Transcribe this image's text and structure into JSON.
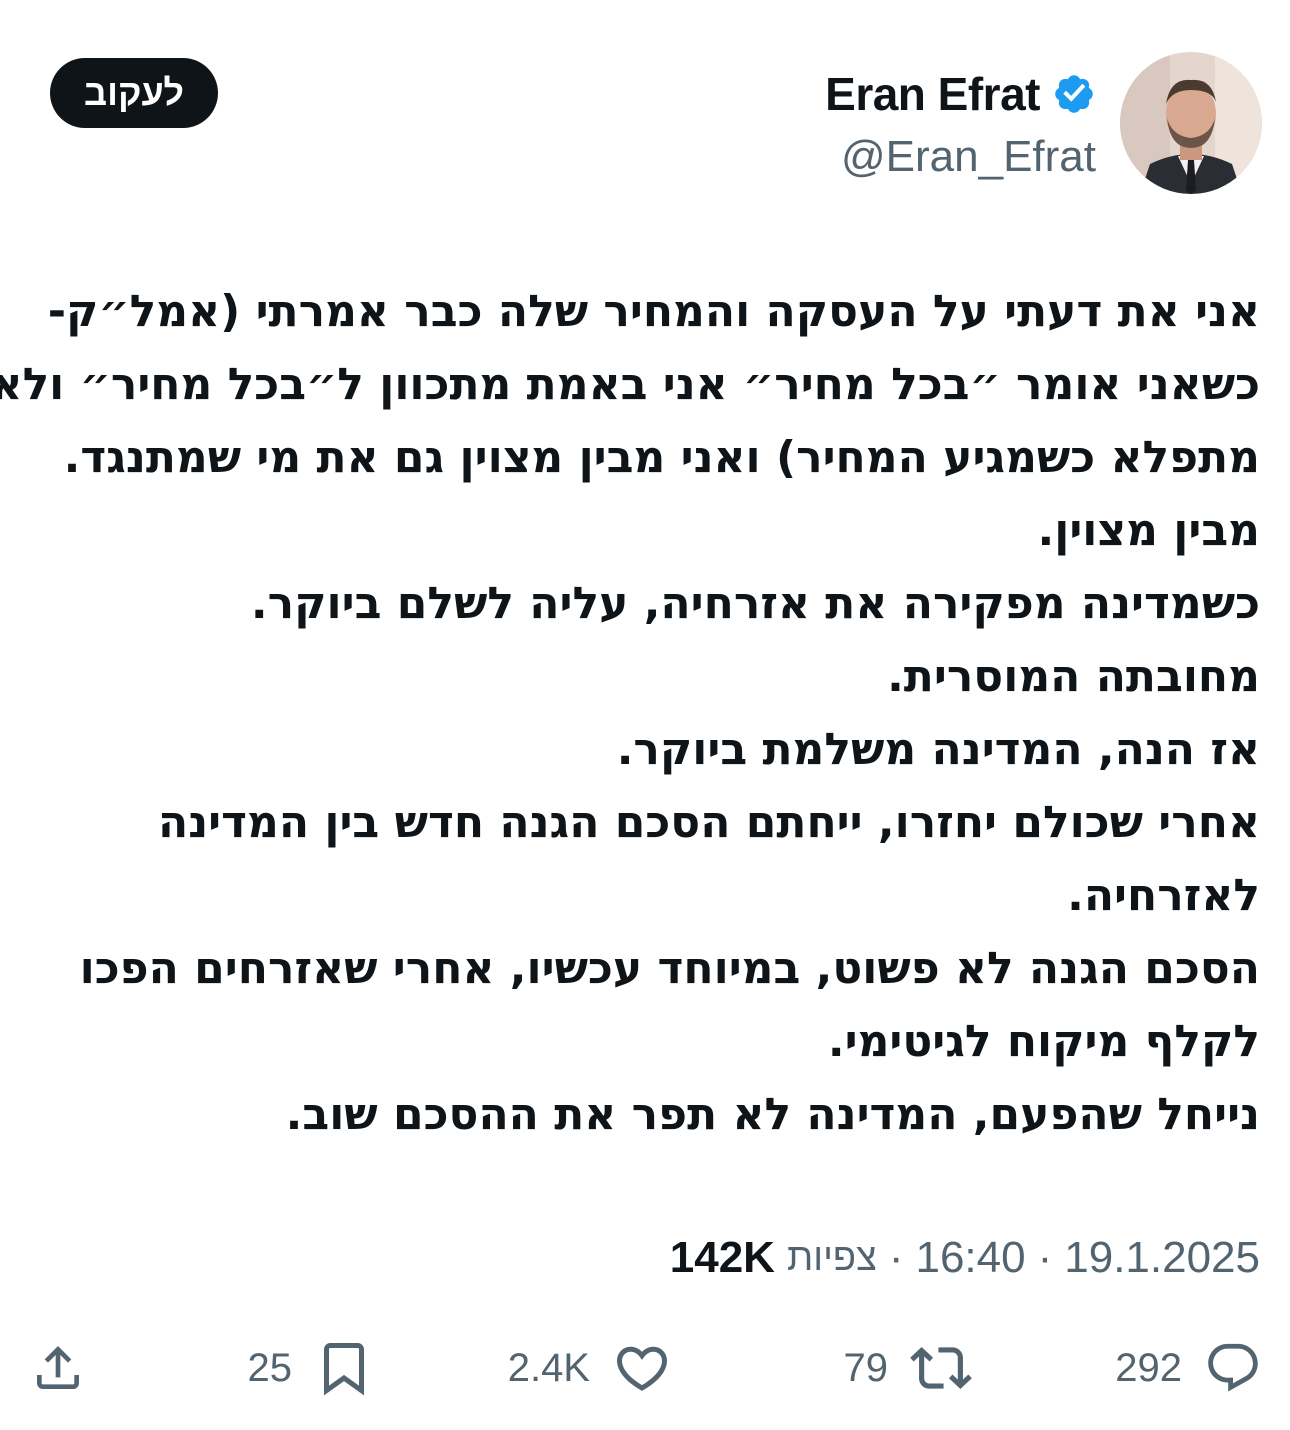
{
  "author": {
    "display_name": "Eran Efrat",
    "handle": "@Eran_Efrat",
    "verified": true,
    "badge_color": "#1d9bf0",
    "avatar_icon": "profile-photo"
  },
  "follow_button": {
    "label": "לעקוב"
  },
  "tweet": {
    "lines": [
      "אני את דעתי על העסקה והמחיר שלה כבר אמרתי (אמל״ק-",
      "כשאני אומר ״בכל מחיר״ אני באמת מתכוון ל״בכל מחיר״ ולא",
      "מתפלא כשמגיע המחיר) ואני מבין מצוין גם את מי שמתנגד.",
      "מבין מצוין.",
      "כשמדינה מפקירה את אזרחיה, עליה לשלם ביוקר.",
      "מחובתה המוסרית.",
      "אז הנה, המדינה משלמת ביוקר.",
      "אחרי שכולם יחזרו, ייחתם הסכם הגנה חדש בין המדינה",
      "לאזרחיה.",
      "הסכם הגנה לא פשוט, במיוחד עכשיו, אחרי שאזרחים הפכו",
      "לקלף מיקוח לגיטימי.",
      "נייחל שהפעם, המדינה לא תפר את ההסכם שוב."
    ]
  },
  "meta": {
    "date": "19.1.2025",
    "separator": "·",
    "time": "16:40",
    "views_label": "צפיות",
    "views": "142K"
  },
  "actions": {
    "reply": {
      "icon": "reply-icon",
      "count": "292"
    },
    "repost": {
      "icon": "repost-icon",
      "count": "79"
    },
    "like": {
      "icon": "heart-icon",
      "count": "2.4K"
    },
    "bookmark": {
      "icon": "bookmark-icon",
      "count": "25"
    },
    "share": {
      "icon": "share-icon"
    }
  },
  "colors": {
    "text": "#0f1419",
    "secondary": "#536471",
    "button_bg": "#0f1419"
  }
}
